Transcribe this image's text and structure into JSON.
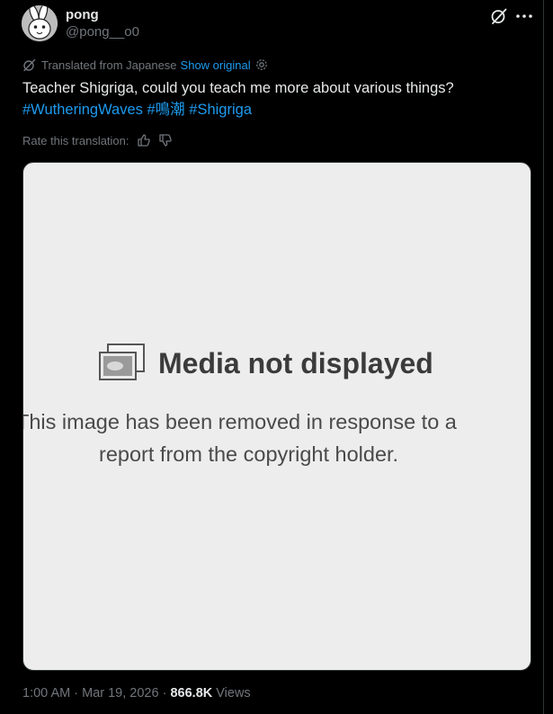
{
  "user": {
    "display_name": "pong",
    "handle": "@pong__o0",
    "avatar": "rabbit-avatar"
  },
  "header_actions": {
    "grok_icon": "grok-icon",
    "more_icon": "more-icon"
  },
  "translation": {
    "label": "Translated from Japanese",
    "show_original": "Show original",
    "rate_label": "Rate this translation:"
  },
  "tweet": {
    "text": "Teacher Shigriga, could you teach me more about various things?",
    "hashtags": [
      "#WutheringWaves",
      "#鳴潮",
      "#Shigriga"
    ]
  },
  "media": {
    "title": "Media not displayed",
    "description_line1": "This image has been removed in response to a",
    "description_line2": "report from the copyright holder."
  },
  "meta": {
    "time": "1:00 AM",
    "separator": "·",
    "date": "Mar 19, 2026",
    "views_count": "866.8K",
    "views_label": "Views"
  },
  "colors": {
    "background": "#000000",
    "text": "#e7e9ea",
    "secondary": "#71767b",
    "link": "#1d9bf0",
    "media_bg": "#ededed"
  }
}
